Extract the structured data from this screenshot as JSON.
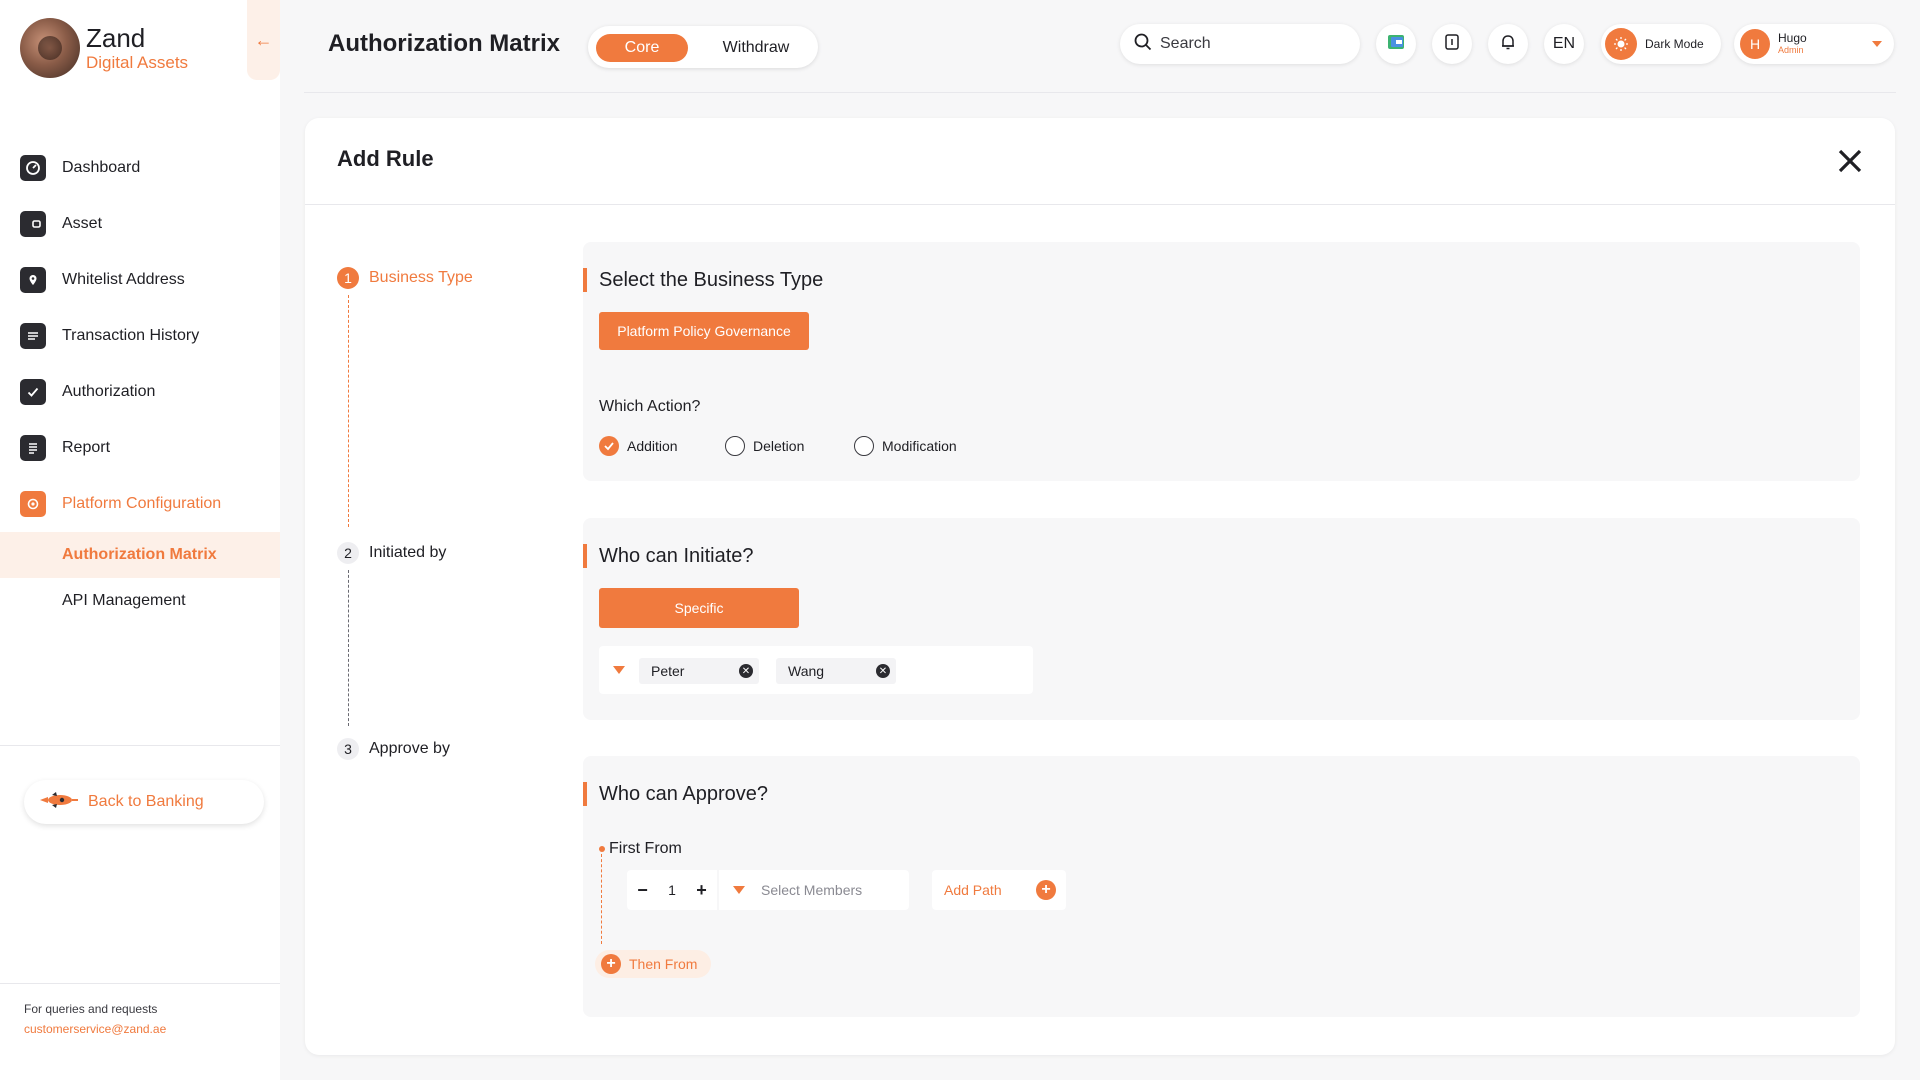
{
  "brand": {
    "name": "Zand",
    "sub": "Digital Assets"
  },
  "sidebar": {
    "items": [
      {
        "label": "Dashboard"
      },
      {
        "label": "Asset"
      },
      {
        "label": "Whitelist Address"
      },
      {
        "label": "Transaction History"
      },
      {
        "label": "Authorization"
      },
      {
        "label": "Report"
      },
      {
        "label": "Platform Configuration"
      }
    ],
    "subitems": [
      {
        "label": "Authorization Matrix"
      },
      {
        "label": "API Management"
      }
    ],
    "back_label": "Back to Banking",
    "footer_text": "For queries and requests",
    "footer_email": "customerservice@zand.ae"
  },
  "header": {
    "title": "Authorization Matrix",
    "tabs": [
      "Core",
      "Withdraw"
    ],
    "search_placeholder": "Search",
    "lang": "EN",
    "dark_mode_label": "Dark Mode",
    "user": {
      "initial": "H",
      "name": "Hugo",
      "role": "Admin"
    }
  },
  "modal": {
    "title": "Add Rule",
    "steps": [
      {
        "num": "1",
        "label": "Business Type"
      },
      {
        "num": "2",
        "label": "Initiated by"
      },
      {
        "num": "3",
        "label": "Approve by"
      }
    ],
    "business": {
      "heading": "Select the Business Type",
      "button": "Platform Policy Governance",
      "question": "Which Action?",
      "options": [
        "Addition",
        "Deletion",
        "Modification"
      ],
      "selected": "Addition"
    },
    "initiate": {
      "heading": "Who can Initiate?",
      "button": "Specific",
      "chips": [
        "Peter",
        "Wang"
      ]
    },
    "approve": {
      "heading": "Who can Approve?",
      "first_from": "First From",
      "count": "1",
      "members_placeholder": "Select Members",
      "add_path": "Add Path",
      "then_from": "Then From"
    }
  },
  "colors": {
    "accent": "#f07a3e",
    "accent_light": "#fdf0e8",
    "bg": "#f7f7f8",
    "text": "#1f1f24"
  }
}
